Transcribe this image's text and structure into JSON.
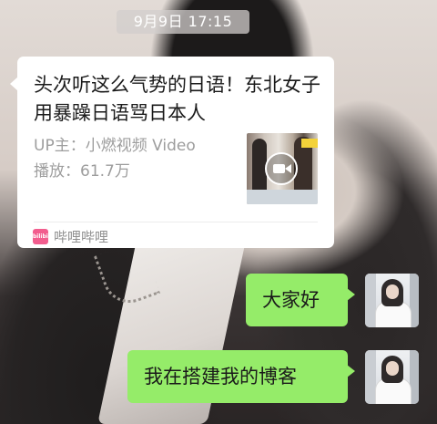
{
  "chat": {
    "timestamp": "9月9日 17:15"
  },
  "share_card": {
    "title": "头次听这么气势的日语！东北女子用暴躁日语骂日本人",
    "uploader_label": "UP主：",
    "uploader": "小燃视频 Video",
    "plays_label": "播放：",
    "plays": "61.7万",
    "thumbnail_icon": "video-camera-icon",
    "source_app": "哔哩哔哩",
    "source_logo_text": "bilibili",
    "source_color": "#f25d8e"
  },
  "messages": [
    {
      "text": "大家好",
      "sender": "self"
    },
    {
      "text": "我在搭建我的博客",
      "sender": "self"
    }
  ],
  "colors": {
    "sent_bubble": "#95ec69",
    "card_bg": "#ffffff",
    "meta_text": "#9d9d9d"
  }
}
